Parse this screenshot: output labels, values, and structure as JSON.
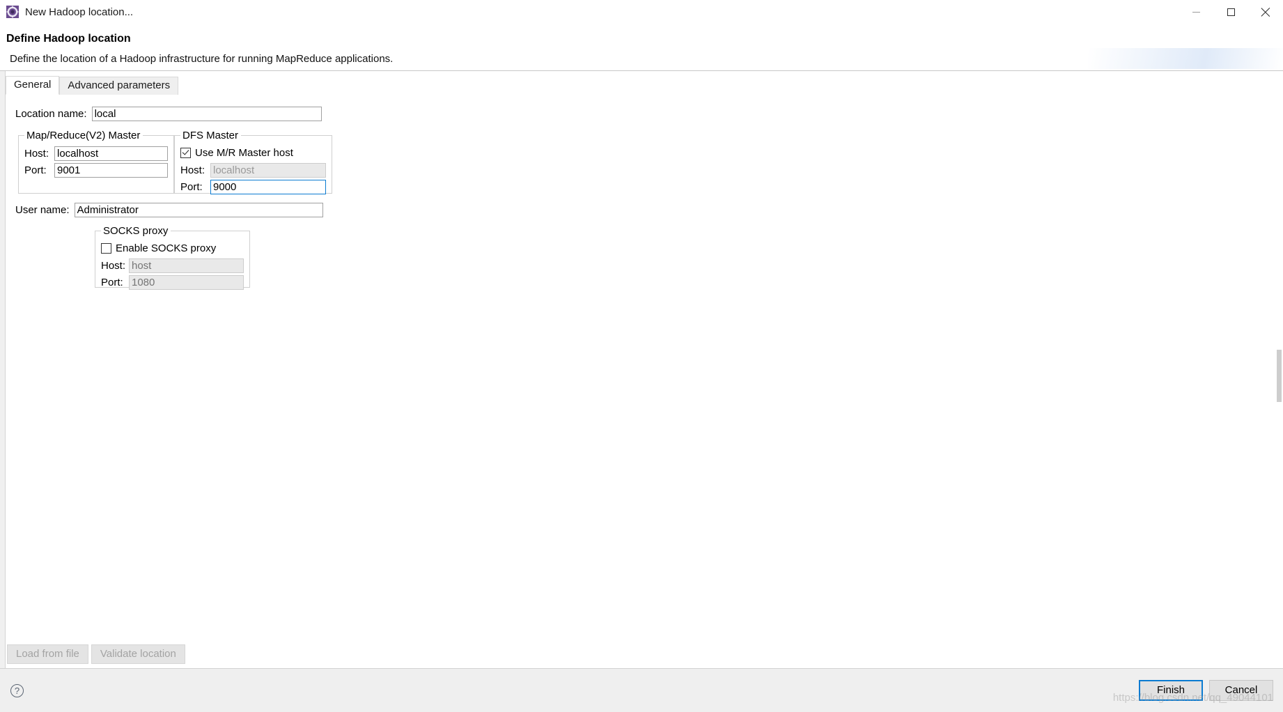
{
  "window": {
    "title": "New Hadoop location...",
    "icon": "hadoop-elephant-icon",
    "minimize_label": "minimize-icon",
    "maximize_label": "maximize-icon",
    "close_label": "close-icon"
  },
  "header": {
    "title": "Define Hadoop location",
    "description": "Define the location of a Hadoop infrastructure for running MapReduce applications."
  },
  "tabs": [
    {
      "label": "General",
      "active": true
    },
    {
      "label": "Advanced parameters",
      "active": false
    }
  ],
  "form": {
    "location_name": {
      "label": "Location name:",
      "value": "local"
    },
    "mapreduce_master": {
      "legend": "Map/Reduce(V2) Master",
      "host_label": "Host:",
      "host_value": "localhost",
      "port_label": "Port:",
      "port_value": "9001"
    },
    "dfs_master": {
      "legend": "DFS Master",
      "use_mr_host_label": "Use M/R Master host",
      "use_mr_host_checked": true,
      "host_label": "Host:",
      "host_value": "localhost",
      "host_disabled": true,
      "port_label": "Port:",
      "port_value": "9000",
      "port_focused": true
    },
    "user_name": {
      "label": "User name:",
      "value": "Administrator"
    },
    "socks_proxy": {
      "legend": "SOCKS proxy",
      "enable_label": "Enable SOCKS proxy",
      "enable_checked": false,
      "host_label": "Host:",
      "host_placeholder": "host",
      "port_label": "Port:",
      "port_placeholder": "1080"
    }
  },
  "actions": {
    "load_from_file": "Load from file",
    "validate_location": "Validate location",
    "help": "?",
    "finish": "Finish",
    "cancel": "Cancel"
  },
  "watermark": "https://blog.csdn.net/qq_49044101",
  "colors": {
    "focus_blue": "#0a7bd1",
    "disabled_text": "#9a9a9a",
    "panel_grey": "#efefef"
  }
}
